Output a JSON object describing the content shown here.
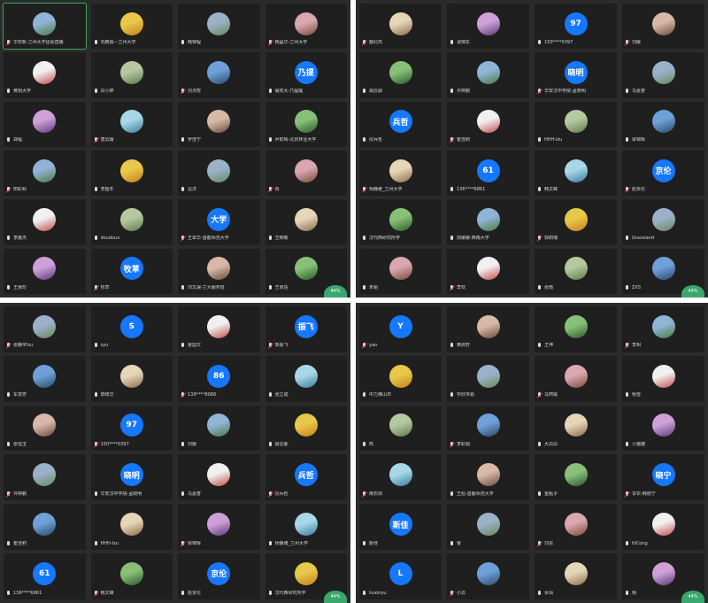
{
  "panels": [
    {
      "badge": "44%",
      "tiles": [
        {
          "avatar": "photo",
          "name": "华欢新·兰州大学团会直播",
          "active": true
        },
        {
          "avatar": "photo",
          "name": "刘鹏霖—兰州大学"
        },
        {
          "avatar": "photo",
          "name": "韩锦程"
        },
        {
          "avatar": "photo",
          "name": "韩晶华-兰州大学"
        },
        {
          "avatar": "photo",
          "name": "黄玥大学"
        },
        {
          "avatar": "photo",
          "name": "白小婷"
        },
        {
          "avatar": "photo",
          "name": "刘沐秀"
        },
        {
          "avatar": "text",
          "text": "乃提",
          "name": "晨欢大-乃提醒"
        },
        {
          "avatar": "photo",
          "name": "郑程"
        },
        {
          "avatar": "photo",
          "name": "唐云霜"
        },
        {
          "avatar": "photo",
          "name": "罗佳宁"
        },
        {
          "avatar": "photo",
          "name": "尹影晴-北京林业大学"
        },
        {
          "avatar": "photo",
          "name": "田彩秋"
        },
        {
          "avatar": "photo",
          "name": "李韶冬"
        },
        {
          "avatar": "photo",
          "name": "逗洋"
        },
        {
          "avatar": "photo",
          "name": "再"
        },
        {
          "avatar": "photo",
          "name": "李雅杰"
        },
        {
          "avatar": "photo",
          "name": "doudoux"
        },
        {
          "avatar": "text",
          "text": "大学",
          "name": "王翠华-首都师范大学"
        },
        {
          "avatar": "photo",
          "name": "王映暖"
        },
        {
          "avatar": "photo",
          "name": "王惠珍"
        },
        {
          "avatar": "text",
          "text": "牧草",
          "name": "牧草"
        },
        {
          "avatar": "photo",
          "name": "刘文澜-兰大服务班"
        },
        {
          "avatar": "photo",
          "name": "王家信"
        }
      ]
    },
    {
      "badge": "44%",
      "tiles": [
        {
          "avatar": "photo",
          "name": "翻北鸡"
        },
        {
          "avatar": "photo",
          "name": "谈锦东"
        },
        {
          "avatar": "text",
          "text": "97",
          "name": "150****0397"
        },
        {
          "avatar": "photo",
          "name": "刘媛"
        },
        {
          "avatar": "photo",
          "name": "胡云鄞"
        },
        {
          "avatar": "photo",
          "name": "许婷鹏"
        },
        {
          "avatar": "text",
          "text": "晓明",
          "name": "华安汉中学院-孟晓明"
        },
        {
          "avatar": "photo",
          "name": "马嘉誉"
        },
        {
          "avatar": "text",
          "text": "兵哲",
          "name": "仪兵哲"
        },
        {
          "avatar": "photo",
          "name": "崔佳莉"
        },
        {
          "avatar": "photo",
          "name": "HHH-Izu"
        },
        {
          "avatar": "photo",
          "name": "梁锦辉"
        },
        {
          "avatar": "photo",
          "name": "杨静雅_兰州大学"
        },
        {
          "avatar": "text",
          "text": "61",
          "name": "136****6861"
        },
        {
          "avatar": "photo",
          "name": "韩文峰"
        },
        {
          "avatar": "text",
          "text": "京伦",
          "name": "赵京伦"
        },
        {
          "avatar": "photo",
          "name": "汉代西研究所学"
        },
        {
          "avatar": "photo",
          "name": "郭娜娜-西南大学"
        },
        {
          "avatar": "photo",
          "name": "郭莉瑞"
        },
        {
          "avatar": "photo",
          "name": "Grassland"
        },
        {
          "avatar": "photo",
          "name": "朱韬"
        },
        {
          "avatar": "photo",
          "name": "李欢"
        },
        {
          "avatar": "photo",
          "name": "张雨"
        },
        {
          "avatar": "photo",
          "name": "ZXS"
        }
      ]
    },
    {
      "badge": "44%",
      "tiles": [
        {
          "avatar": "photo",
          "name": "张静宇lzu"
        },
        {
          "avatar": "text",
          "text": "S",
          "name": "syu"
        },
        {
          "avatar": "photo",
          "name": "曹国文"
        },
        {
          "avatar": "text",
          "text": "振飞",
          "name": "郭振飞"
        },
        {
          "avatar": "photo",
          "name": "车慧芳"
        },
        {
          "avatar": "photo",
          "name": "田晓华"
        },
        {
          "avatar": "text",
          "text": "86",
          "name": "139****8086"
        },
        {
          "avatar": "photo",
          "name": "张立成"
        },
        {
          "avatar": "photo",
          "name": "张钰玉"
        },
        {
          "avatar": "text",
          "text": "97",
          "name": "150****0397"
        },
        {
          "avatar": "photo",
          "name": "刘媛"
        },
        {
          "avatar": "photo",
          "name": "胡云鄞"
        },
        {
          "avatar": "photo",
          "name": "许婷鹏"
        },
        {
          "avatar": "text",
          "text": "晓明",
          "name": "华安汉中学院-孟晓明"
        },
        {
          "avatar": "photo",
          "name": "马嘉誉"
        },
        {
          "avatar": "text",
          "text": "兵哲",
          "name": "仪兵哲"
        },
        {
          "avatar": "photo",
          "name": "崔佳莉"
        },
        {
          "avatar": "photo",
          "name": "HHH-Izu"
        },
        {
          "avatar": "photo",
          "name": "梁锦辉"
        },
        {
          "avatar": "photo",
          "name": "杨静雅_兰州大学"
        },
        {
          "avatar": "text",
          "text": "61",
          "name": "136****6861"
        },
        {
          "avatar": "photo",
          "name": "韩文峰"
        },
        {
          "avatar": "text",
          "text": "京伦",
          "name": "赵京伦"
        },
        {
          "avatar": "photo",
          "name": "汉代西研究所学"
        }
      ]
    },
    {
      "badge": "44%",
      "tiles": [
        {
          "avatar": "text",
          "text": "Y",
          "name": "yao"
        },
        {
          "avatar": "photo",
          "name": "黄启轩"
        },
        {
          "avatar": "photo",
          "name": "王坤"
        },
        {
          "avatar": "photo",
          "name": "李玥"
        },
        {
          "avatar": "photo",
          "name": "中力佛山市"
        },
        {
          "avatar": "photo",
          "name": "宇欣韦铭"
        },
        {
          "avatar": "photo",
          "name": "马珂威"
        },
        {
          "avatar": "photo",
          "name": "杨雪"
        },
        {
          "avatar": "photo",
          "name": "鸣"
        },
        {
          "avatar": "photo",
          "name": "李彩娟"
        },
        {
          "avatar": "photo",
          "name": "大白白"
        },
        {
          "avatar": "photo",
          "name": "小猪糖"
        },
        {
          "avatar": "photo",
          "name": "雨衣剑"
        },
        {
          "avatar": "photo",
          "name": "王彪-首都师范大学"
        },
        {
          "avatar": "photo",
          "name": "金瓶子"
        },
        {
          "avatar": "text",
          "text": "晓宁",
          "name": "甘农-韩晓宁"
        },
        {
          "avatar": "text",
          "text": "斯佳",
          "name": "斯佳"
        },
        {
          "avatar": "photo",
          "name": "曹"
        },
        {
          "avatar": "photo",
          "name": "刘思"
        },
        {
          "avatar": "photo",
          "name": "ltlCong"
        },
        {
          "avatar": "text",
          "text": "L",
          "name": "liuxinyu"
        },
        {
          "avatar": "photo",
          "name": "小云"
        },
        {
          "avatar": "photo",
          "name": "水仙"
        },
        {
          "avatar": "photo",
          "name": "杨"
        }
      ]
    }
  ]
}
